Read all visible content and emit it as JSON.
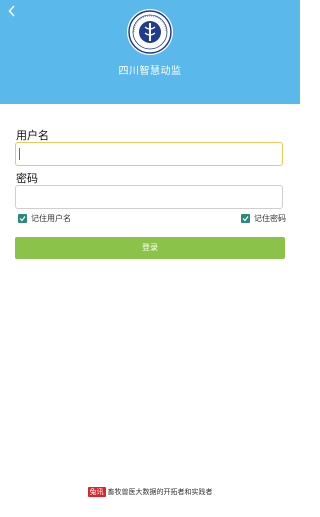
{
  "header": {
    "title": "四川智慧动监",
    "background_color": "#5ab9ea",
    "logo_icon": "organization-seal-logo",
    "logo_text": "四川省动物卫生监督"
  },
  "form": {
    "username_label": "用户名",
    "username_value": "",
    "password_label": "密码",
    "password_value": "",
    "remember_username": {
      "label": "记住用户名",
      "checked": true
    },
    "remember_password": {
      "label": "记住密码",
      "checked": true
    },
    "login_button": "登录",
    "accent_color": "#8bc34a",
    "checkbox_color": "#2a8a7a"
  },
  "footer": {
    "brand": "兔讯",
    "text": "畜牧兽医大数据的开拓者和实践者",
    "brand_color": "#d8262f"
  }
}
